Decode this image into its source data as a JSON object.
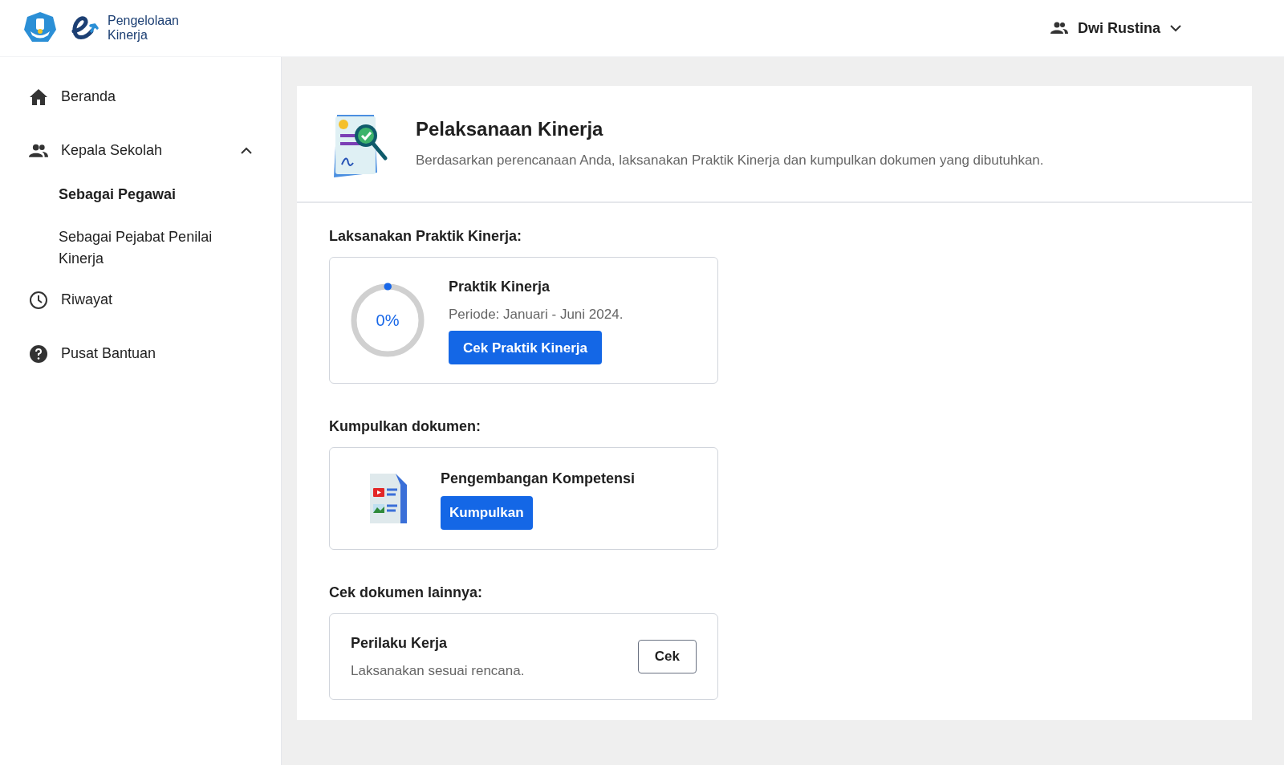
{
  "header": {
    "logo_text": [
      "Pengelolaan",
      "Kinerja"
    ],
    "user": {
      "name": "Dwi Rustina"
    }
  },
  "sidebar": {
    "items": [
      {
        "kind": "link",
        "label": "Beranda"
      },
      {
        "kind": "group",
        "label": "Kepala Sekolah",
        "expanded": true,
        "children": [
          {
            "label": "Sebagai Pegawai",
            "selected": true
          },
          {
            "label": "Sebagai Pejabat Penilai Kinerja",
            "selected": false
          }
        ]
      },
      {
        "kind": "link",
        "label": "Riwayat"
      },
      {
        "kind": "link",
        "label": "Pusat Bantuan"
      }
    ]
  },
  "page": {
    "title": "Pelaksanaan Kinerja",
    "subtitle": "Berdasarkan perencanaan Anda, laksanakan Praktik Kinerja dan kumpulkan dokumen yang dibutuhkan."
  },
  "sections": [
    {
      "kind": "progress",
      "heading": "Laksanakan Praktik Kinerja:",
      "title": "Praktik Kinerja",
      "description": "Periode: Januari - Juni 2024.",
      "level": 0,
      "reading": "0%",
      "button": "Cek Praktik Kinerja"
    },
    {
      "kind": "document",
      "heading": "Kumpulkan dokumen:",
      "title": "Pengembangan Kompetensi",
      "button": "Kumpulkan"
    },
    {
      "kind": "check",
      "heading": "Cek dokumen lainnya:",
      "title": "Perilaku Kerja",
      "description": "Laksanakan sesuai rencana.",
      "button": "Cek"
    }
  ]
}
